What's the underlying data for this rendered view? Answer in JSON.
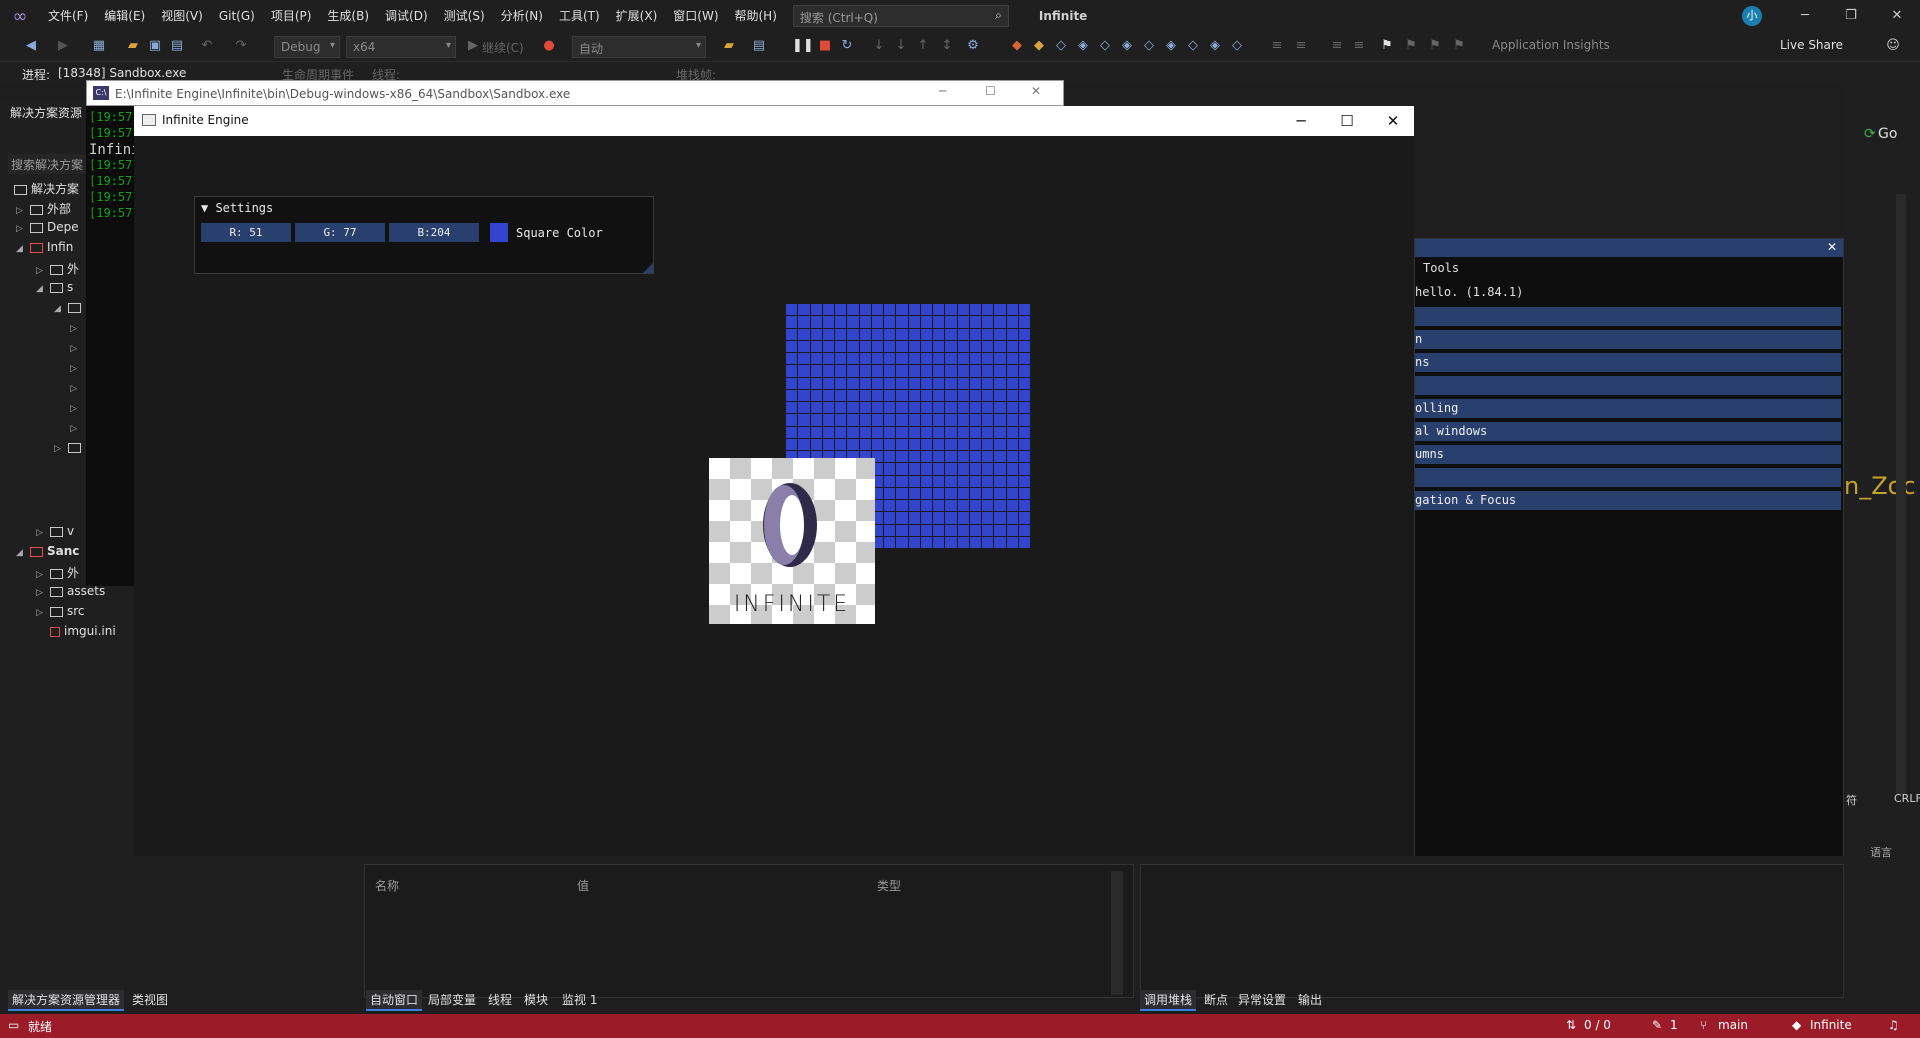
{
  "vs": {
    "menus": [
      "文件(F)",
      "编辑(E)",
      "视图(V)",
      "Git(G)",
      "项目(P)",
      "生成(B)",
      "调试(D)",
      "测试(S)",
      "分析(N)",
      "工具(T)",
      "扩展(X)",
      "窗口(W)",
      "帮助(H)"
    ],
    "search_placeholder": "搜索 (Ctrl+Q)",
    "title": "Infinite",
    "avatar": "小",
    "toolbar": {
      "config": "Debug",
      "platform": "x64",
      "continue": "继续(C)",
      "auto": "自动",
      "insights": "Application Insights",
      "liveshare": "Live Share"
    },
    "process": {
      "label": "进程:",
      "value": "[18348] Sandbox.exe",
      "lifecycle": "生命周期事件",
      "thread": "线程:",
      "stack": "堆栈帧:"
    }
  },
  "solution": {
    "header": "解决方案资源",
    "search": "搜索解决方案",
    "rows": [
      "解决方案",
      "外部",
      "Depe",
      "Infin",
      "外",
      "s",
      "v",
      "Sanc",
      "外",
      "assets",
      "src",
      "imgui.ini"
    ]
  },
  "console": {
    "title": "E:\\Infinite Engine\\Infinite\\bin\\Debug-windows-x86_64\\Sandbox\\Sandbox.exe",
    "lines": [
      "[19:57",
      "[19:57",
      "Infini",
      "[19:57",
      "[19:57",
      "[19:57",
      "[19:57"
    ]
  },
  "engine": {
    "title": "Infinite Engine",
    "settings": {
      "header": "Settings",
      "r": "R: 51",
      "g": "G: 77",
      "b": "B:204",
      "swatch_label": "Square Color",
      "swatch_color": "#3345cc"
    },
    "logo_text": "INFINITE"
  },
  "demo": {
    "tools": "Tools",
    "hello": "hello. (1.84.1)",
    "rows": [
      "",
      "n",
      "ns",
      "",
      "olling",
      "al windows",
      "umns",
      "",
      "gation & Focus"
    ]
  },
  "right_strip": {
    "go": "Go",
    "zoom": "n_Zoc",
    "crlf": "CRLF",
    "fu": "符",
    "lang": "语言"
  },
  "bottom": {
    "col_name": "名称",
    "col_value": "值",
    "col_type": "类型"
  },
  "tabs_left": [
    "解决方案资源管理器",
    "类视图"
  ],
  "tabs_mid": [
    "自动窗口",
    "局部变量",
    "线程",
    "模块",
    "监视 1"
  ],
  "tabs_right": [
    "调用堆栈",
    "断点",
    "异常设置",
    "输出"
  ],
  "status": {
    "ready": "就绪",
    "changes": "0 / 0",
    "pencil": "1",
    "branch": "main",
    "repo": "Infinite"
  }
}
